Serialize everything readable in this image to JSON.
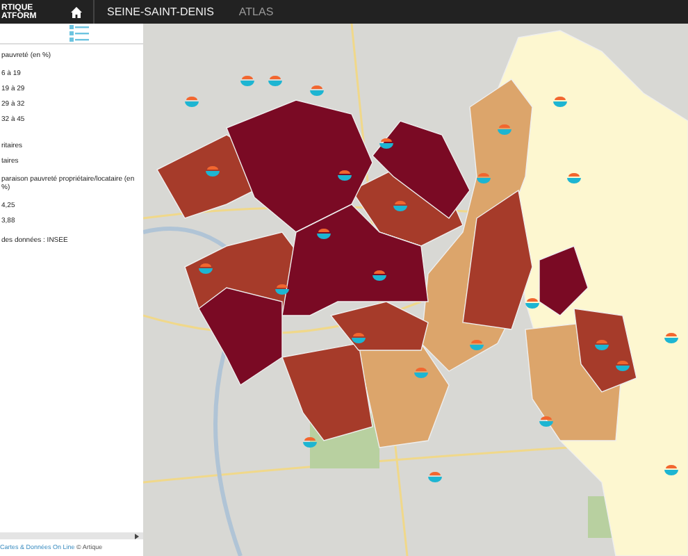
{
  "navbar": {
    "logo_lines": [
      "RTIQUE",
      "ATFORM"
    ],
    "items": [
      {
        "label": "SEINE-SAINT-DENIS",
        "selected": true
      },
      {
        "label": "ATLAS",
        "selected": false
      }
    ]
  },
  "legend": {
    "title": "pauvreté (en %)",
    "classes": [
      "6 à 19",
      "19 à 29",
      "29 à 32",
      "32 à 45"
    ],
    "symbols": [
      "ritaires",
      "taires"
    ],
    "comparison_title": "paraison pauvreté propriétaire/locataire (en %)",
    "comparison_values": [
      "4,25",
      "3,88"
    ],
    "source": "des données : INSEE"
  },
  "footer": {
    "link": "Cartes & Données On Line",
    "credit": "© Artique"
  }
}
